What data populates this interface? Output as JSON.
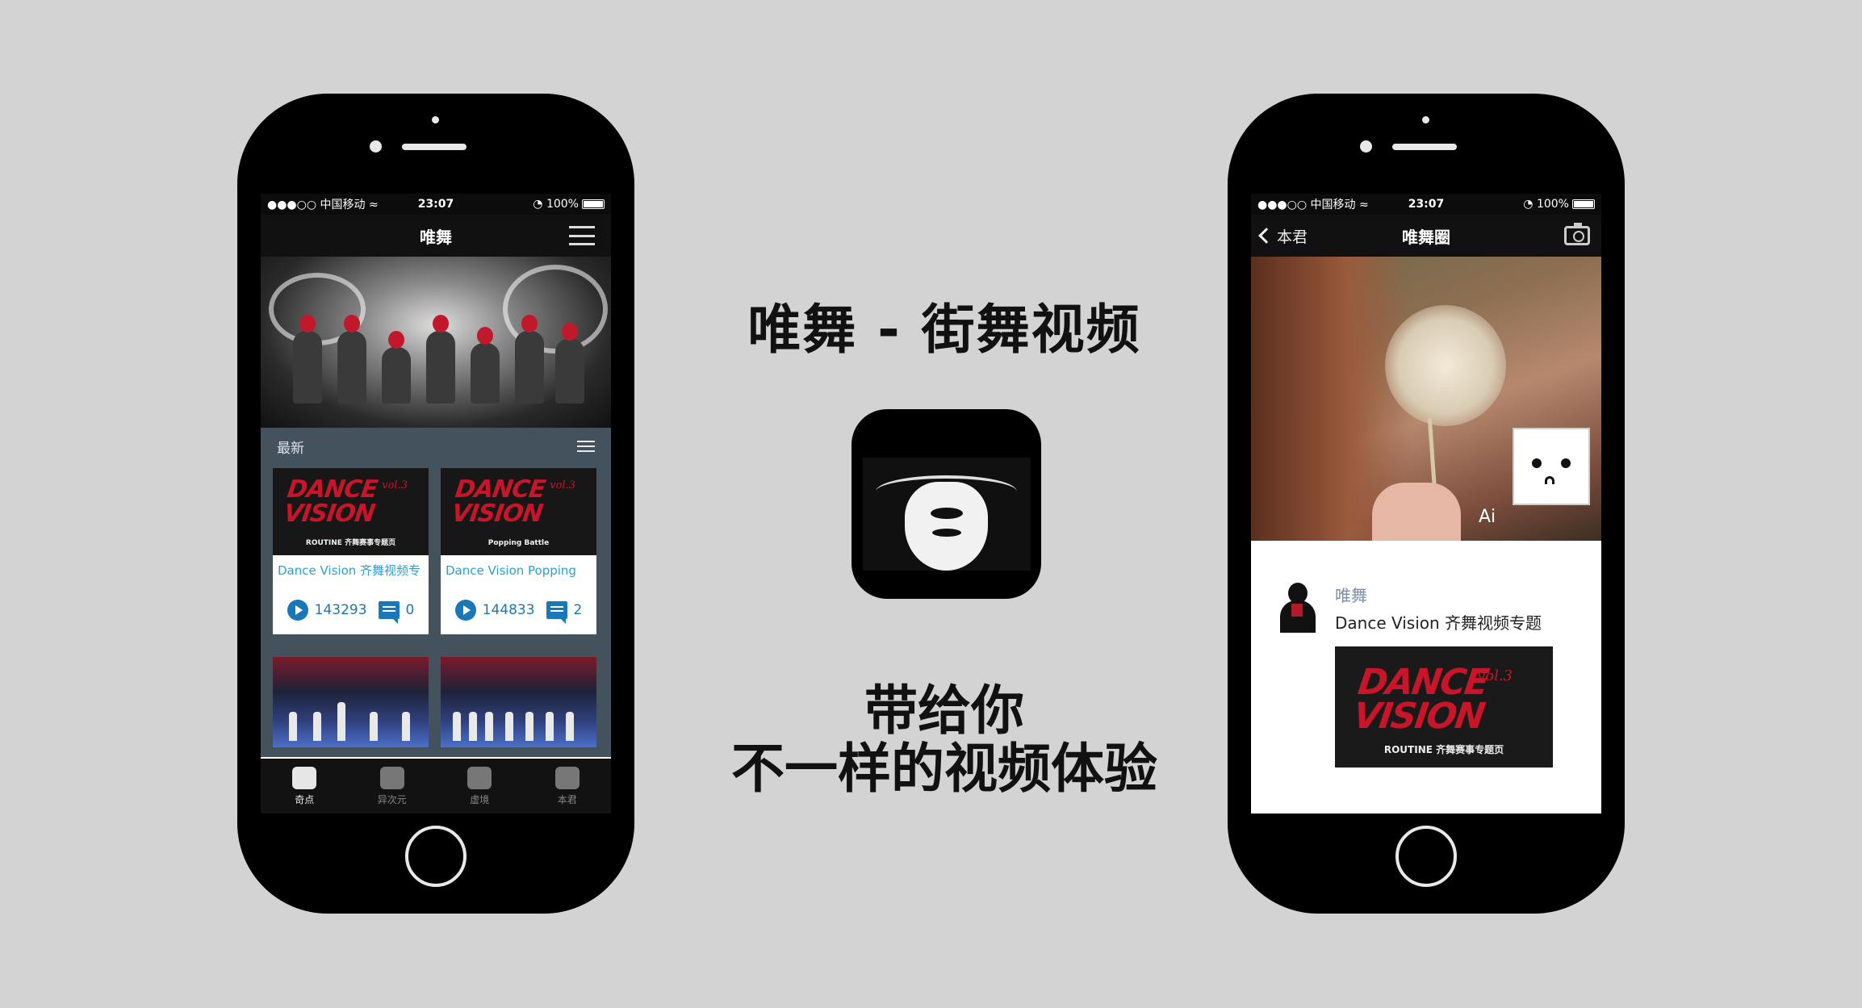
{
  "center": {
    "app_title": "唯舞 - 街舞视频",
    "slogan_line1": "带给你",
    "slogan_line2": "不一样的视频体验"
  },
  "left_phone": {
    "status": {
      "carrier": "●●●○○ 中国移动 ≈",
      "time": "23:07",
      "battery": "◔ 100%"
    },
    "nav_title": "唯舞",
    "section_title": "最新",
    "cards": [
      {
        "thumb_title": "DANCE VISION",
        "thumb_vol": "vol.3",
        "thumb_sub": "ROUTINE 齐舞赛事专题页",
        "title": "Dance Vision 齐舞视频专",
        "plays": "143293",
        "comments": "0"
      },
      {
        "thumb_title": "DANCE VISION",
        "thumb_vol": "vol.3",
        "thumb_sub": "Popping Battle",
        "title": "Dance Vision Popping",
        "plays": "144833",
        "comments": "2"
      }
    ],
    "tabs": [
      {
        "label": "奇点",
        "icon": "hands-icon",
        "active": true
      },
      {
        "label": "异次元",
        "icon": "clap-icon",
        "active": false
      },
      {
        "label": "虚境",
        "icon": "mask-icon",
        "active": false
      },
      {
        "label": "本君",
        "icon": "profile-icon",
        "active": false
      }
    ]
  },
  "right_phone": {
    "status": {
      "carrier": "●●●○○ 中国移动 ≈",
      "time": "23:07",
      "battery": "◔ 100%"
    },
    "back_label": "本君",
    "nav_title": "唯舞圈",
    "cover_watermark": "Ai",
    "post": {
      "username": "唯舞",
      "text": "Dance Vision 齐舞视频专题",
      "image_title": "DANCE VISION",
      "image_vol": "vol.3",
      "image_sub": "ROUTINE 齐舞赛事专题页"
    }
  },
  "colors": {
    "background": "#d3d3d3",
    "accent_blue": "#1878b8",
    "dance_red": "#c8152a",
    "section_bg": "#44525d"
  }
}
